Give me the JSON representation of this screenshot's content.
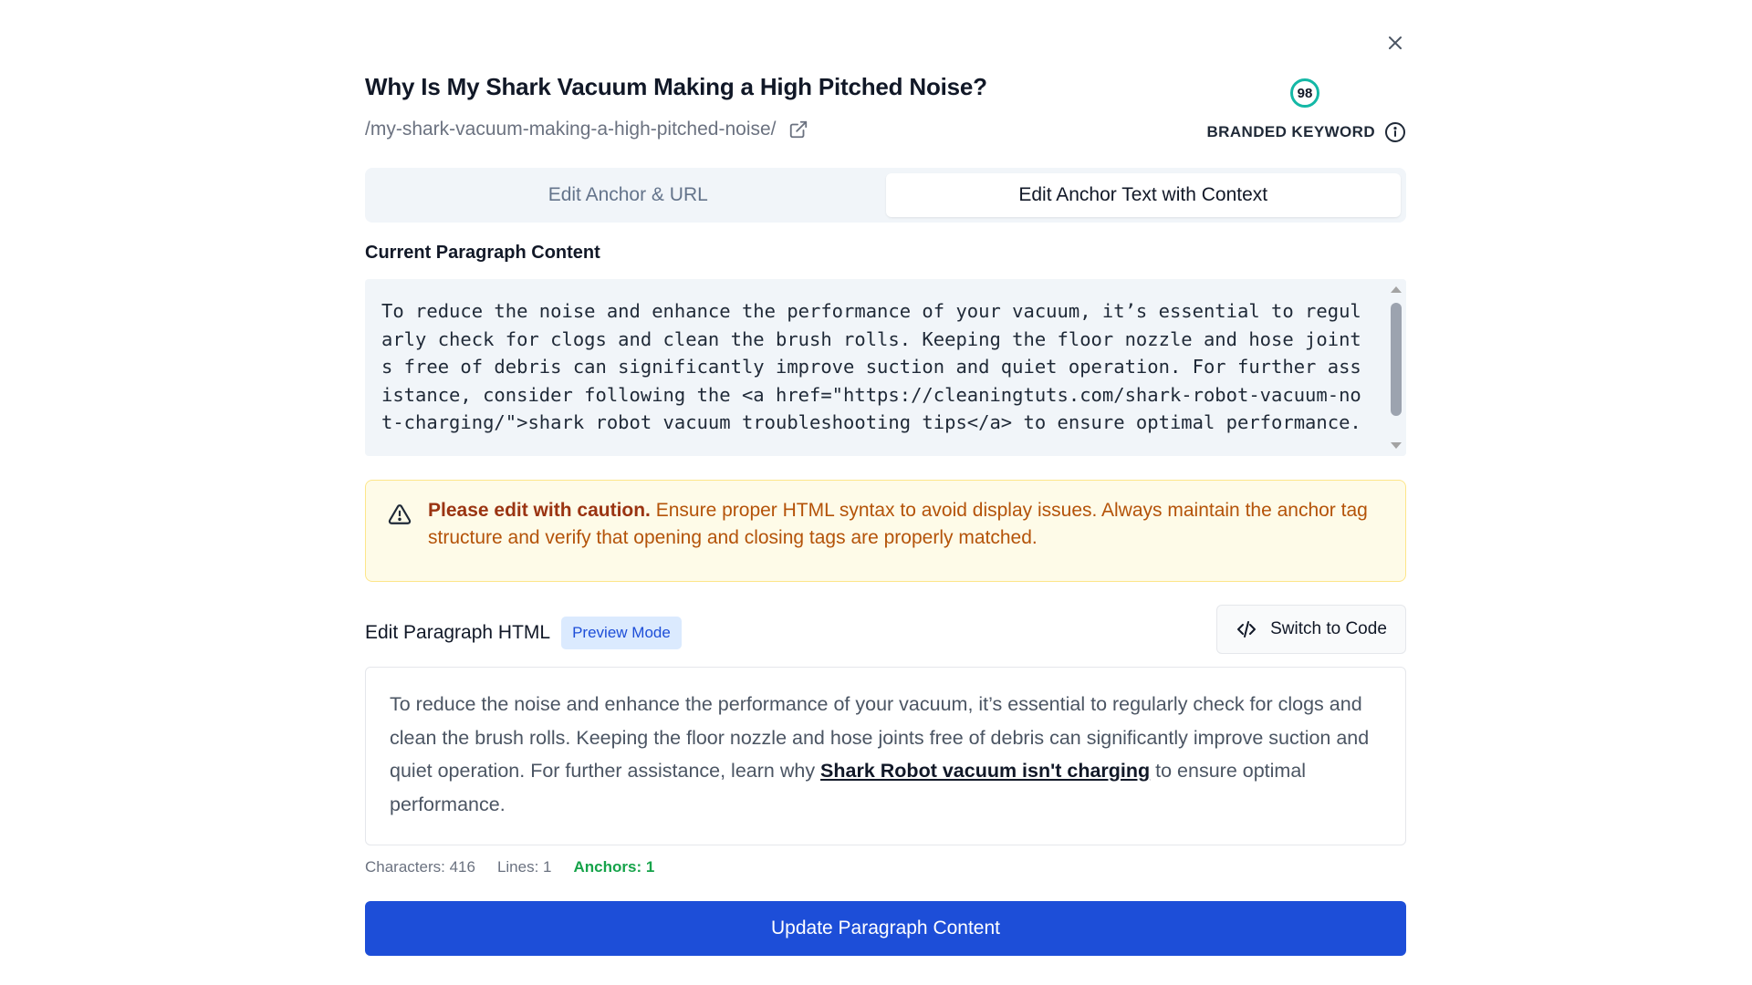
{
  "dialog": {
    "title": "Why Is My Shark Vacuum Making a High Pitched Noise?",
    "url_path": "/my-shark-vacuum-making-a-high-pitched-noise/",
    "score": "98",
    "keyword_type": "BRANDED KEYWORD"
  },
  "tabs": [
    {
      "label": "Edit Anchor & URL",
      "active": false
    },
    {
      "label": "Edit Anchor Text with Context",
      "active": true
    }
  ],
  "current_paragraph": {
    "label": "Current Paragraph Content",
    "value": "To reduce the noise and enhance the performance of your vacuum, it’s essential to regularly check for clogs and clean the brush rolls. Keeping the floor nozzle and hose joints free of debris can significantly improve suction and quiet operation. For further assistance, consider following the <a href=\"https://cleaningtuts.com/shark-robot-vacuum-not-charging/\">shark robot vacuum troubleshooting tips</a> to ensure optimal performance."
  },
  "warning": {
    "bold": "Please edit with caution.",
    "text": " Ensure proper HTML syntax to avoid display issues. Always maintain the anchor tag structure and verify that opening and closing tags are properly matched."
  },
  "editor": {
    "label": "Edit Paragraph HTML",
    "mode_badge": "Preview Mode",
    "switch_label": "Switch to Code",
    "preview_before": "To reduce the noise and enhance the performance of your vacuum, it’s essential to regularly check for clogs and clean the brush rolls. Keeping the floor nozzle and hose joints free of debris can significantly improve suction and quiet operation. For further assistance, learn why ",
    "preview_link": "Shark Robot vacuum isn't charging",
    "preview_after": " to ensure optimal performance."
  },
  "stats": {
    "characters": "Characters: 416",
    "lines": "Lines: 1",
    "anchors": "Anchors: 1"
  },
  "actions": {
    "update_label": "Update Paragraph Content"
  },
  "colors": {
    "primary": "#1d4ed8",
    "score_ring": "#14b8a6",
    "warning_bg": "#fefbe8",
    "warning_text": "#b45309",
    "anchors_green": "#16a34a"
  },
  "icons": {
    "close": "close-icon",
    "external": "external-link-icon",
    "info": "info-icon",
    "warning": "warning-triangle-icon",
    "code": "code-icon"
  }
}
